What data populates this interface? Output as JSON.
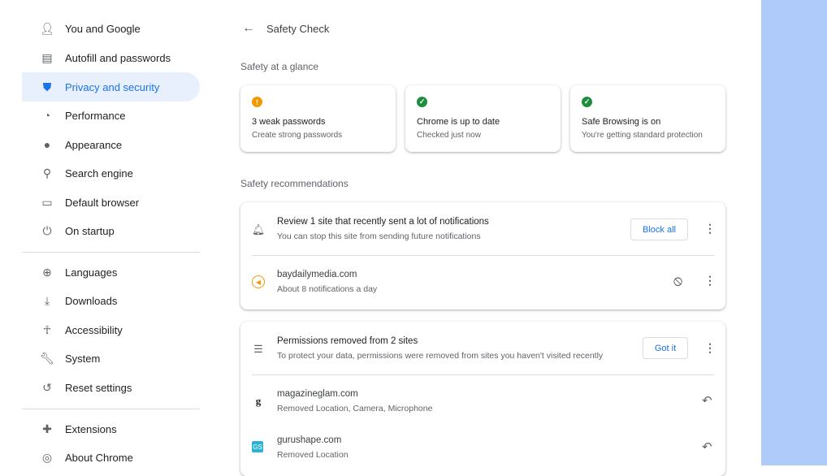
{
  "sidebar": {
    "items": [
      {
        "label": "You and Google",
        "icon": "person-icon"
      },
      {
        "label": "Autofill and passwords",
        "icon": "clipboard-icon"
      },
      {
        "label": "Privacy and security",
        "icon": "shield-icon",
        "active": true
      },
      {
        "label": "Performance",
        "icon": "speedometer-icon"
      },
      {
        "label": "Appearance",
        "icon": "palette-icon"
      },
      {
        "label": "Search engine",
        "icon": "search-icon"
      },
      {
        "label": "Default browser",
        "icon": "browser-icon"
      },
      {
        "label": "On startup",
        "icon": "power-icon"
      },
      {
        "label": "Languages",
        "icon": "globe-icon"
      },
      {
        "label": "Downloads",
        "icon": "download-icon"
      },
      {
        "label": "Accessibility",
        "icon": "accessibility-icon"
      },
      {
        "label": "System",
        "icon": "wrench-icon"
      },
      {
        "label": "Reset settings",
        "icon": "history-icon"
      },
      {
        "label": "Extensions",
        "icon": "puzzle-icon"
      },
      {
        "label": "About Chrome",
        "icon": "chrome-icon"
      }
    ]
  },
  "header": {
    "title": "Safety Check"
  },
  "glance": {
    "heading": "Safety at a glance",
    "cards": [
      {
        "title": "3 weak passwords",
        "subtitle": "Create strong passwords",
        "status": "warning",
        "color": "#f29900"
      },
      {
        "title": "Chrome is up to date",
        "subtitle": "Checked just now",
        "status": "ok",
        "color": "#1e8e3e"
      },
      {
        "title": "Safe Browsing is on",
        "subtitle": "You're getting standard protection",
        "status": "ok",
        "color": "#1e8e3e"
      }
    ]
  },
  "recommendations": {
    "heading": "Safety recommendations",
    "notifications": {
      "title": "Review 1 site that recently sent a lot of notifications",
      "subtitle": "You can stop this site from sending future notifications",
      "button": "Block all",
      "sites": [
        {
          "domain": "baydailymedia.com",
          "detail": "About 8 notifications a day"
        }
      ]
    },
    "permissions": {
      "title": "Permissions removed from 2 sites",
      "subtitle": "To protect your data, permissions were removed from sites you haven't visited recently",
      "button": "Got it",
      "sites": [
        {
          "domain": "magazineglam.com",
          "detail": "Removed Location, Camera, Microphone",
          "favicon": "g"
        },
        {
          "domain": "gurushape.com",
          "detail": "Removed Location",
          "favicon": "GS"
        }
      ]
    }
  },
  "colors": {
    "accent": "#1a73e8",
    "active_bg": "#e8f0fe",
    "side_panel": "#aecbfa"
  }
}
